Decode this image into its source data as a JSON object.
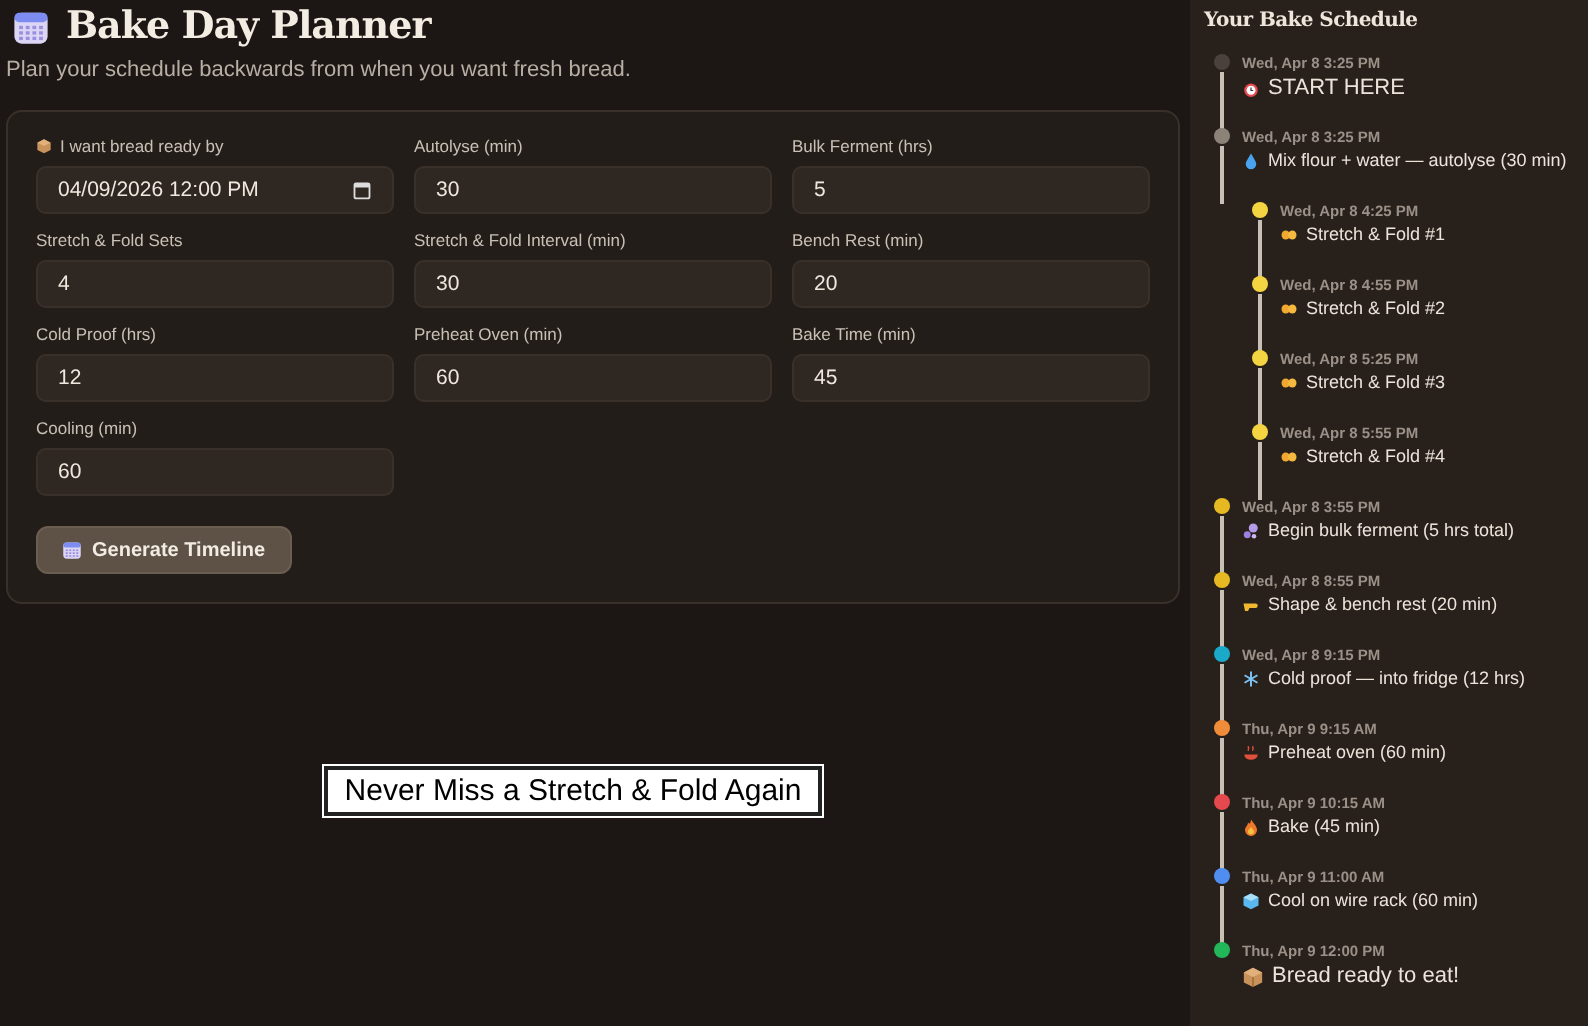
{
  "header": {
    "title": "Bake Day Planner",
    "subtitle": "Plan your schedule backwards from when you want fresh bread."
  },
  "form": {
    "fields": [
      {
        "kind": "datetime",
        "label": "I want bread ready by",
        "value": "04/09/2026 12:00 PM"
      },
      {
        "kind": "number",
        "label": "Autolyse (min)",
        "value": "30"
      },
      {
        "kind": "number",
        "label": "Bulk Ferment (hrs)",
        "value": "5"
      },
      {
        "kind": "number",
        "label": "Stretch & Fold Sets",
        "value": "4"
      },
      {
        "kind": "number",
        "label": "Stretch & Fold Interval (min)",
        "value": "30"
      },
      {
        "kind": "number",
        "label": "Bench Rest (min)",
        "value": "20"
      },
      {
        "kind": "number",
        "label": "Cold Proof (hrs)",
        "value": "12"
      },
      {
        "kind": "number",
        "label": "Preheat Oven (min)",
        "value": "60"
      },
      {
        "kind": "number",
        "label": "Bake Time (min)",
        "value": "45"
      },
      {
        "kind": "number",
        "label": "Cooling (min)",
        "value": "60"
      }
    ],
    "button": "Generate Timeline"
  },
  "caption": "Never Miss a Stretch & Fold Again",
  "schedule": {
    "title": "Your Bake Schedule",
    "steps": [
      {
        "kind": "start",
        "time": "Wed, Apr 8 3:25 PM",
        "label": "START HERE",
        "color": "#4a413a"
      },
      {
        "kind": "mix",
        "time": "Wed, Apr 8 3:25 PM",
        "label": "Mix flour + water — autolyse (30 min)",
        "color": "#8c8278",
        "children": [
          {
            "kind": "fold",
            "time": "Wed, Apr 8 4:25 PM",
            "label": "Stretch & Fold #1",
            "color": "#f5d442"
          },
          {
            "kind": "fold",
            "time": "Wed, Apr 8 4:55 PM",
            "label": "Stretch & Fold #2",
            "color": "#f5d442"
          },
          {
            "kind": "fold",
            "time": "Wed, Apr 8 5:25 PM",
            "label": "Stretch & Fold #3",
            "color": "#f5d442"
          },
          {
            "kind": "fold",
            "time": "Wed, Apr 8 5:55 PM",
            "label": "Stretch & Fold #4",
            "color": "#f5d442"
          }
        ]
      },
      {
        "kind": "bulk",
        "time": "Wed, Apr 8 3:55 PM",
        "label": "Begin bulk ferment (5 hrs total)",
        "color": "#e6b923"
      },
      {
        "kind": "shape",
        "time": "Wed, Apr 8 8:55 PM",
        "label": "Shape & bench rest (20 min)",
        "color": "#e6b923"
      },
      {
        "kind": "cold",
        "time": "Wed, Apr 8 9:15 PM",
        "label": "Cold proof — into fridge (12 hrs)",
        "color": "#1aa9c9"
      },
      {
        "kind": "preheat",
        "time": "Thu, Apr 9 9:15 AM",
        "label": "Preheat oven (60 min)",
        "color": "#ef8c3a"
      },
      {
        "kind": "bake",
        "time": "Thu, Apr 9 10:15 AM",
        "label": "Bake (45 min)",
        "color": "#e5484d"
      },
      {
        "kind": "cool",
        "time": "Thu, Apr 9 11:00 AM",
        "label": "Cool on wire rack (60 min)",
        "color": "#4f8ef0"
      },
      {
        "kind": "ready",
        "time": "Thu, Apr 9 12:00 PM",
        "label": "Bread ready to eat!",
        "color": "#22b85a"
      }
    ]
  }
}
